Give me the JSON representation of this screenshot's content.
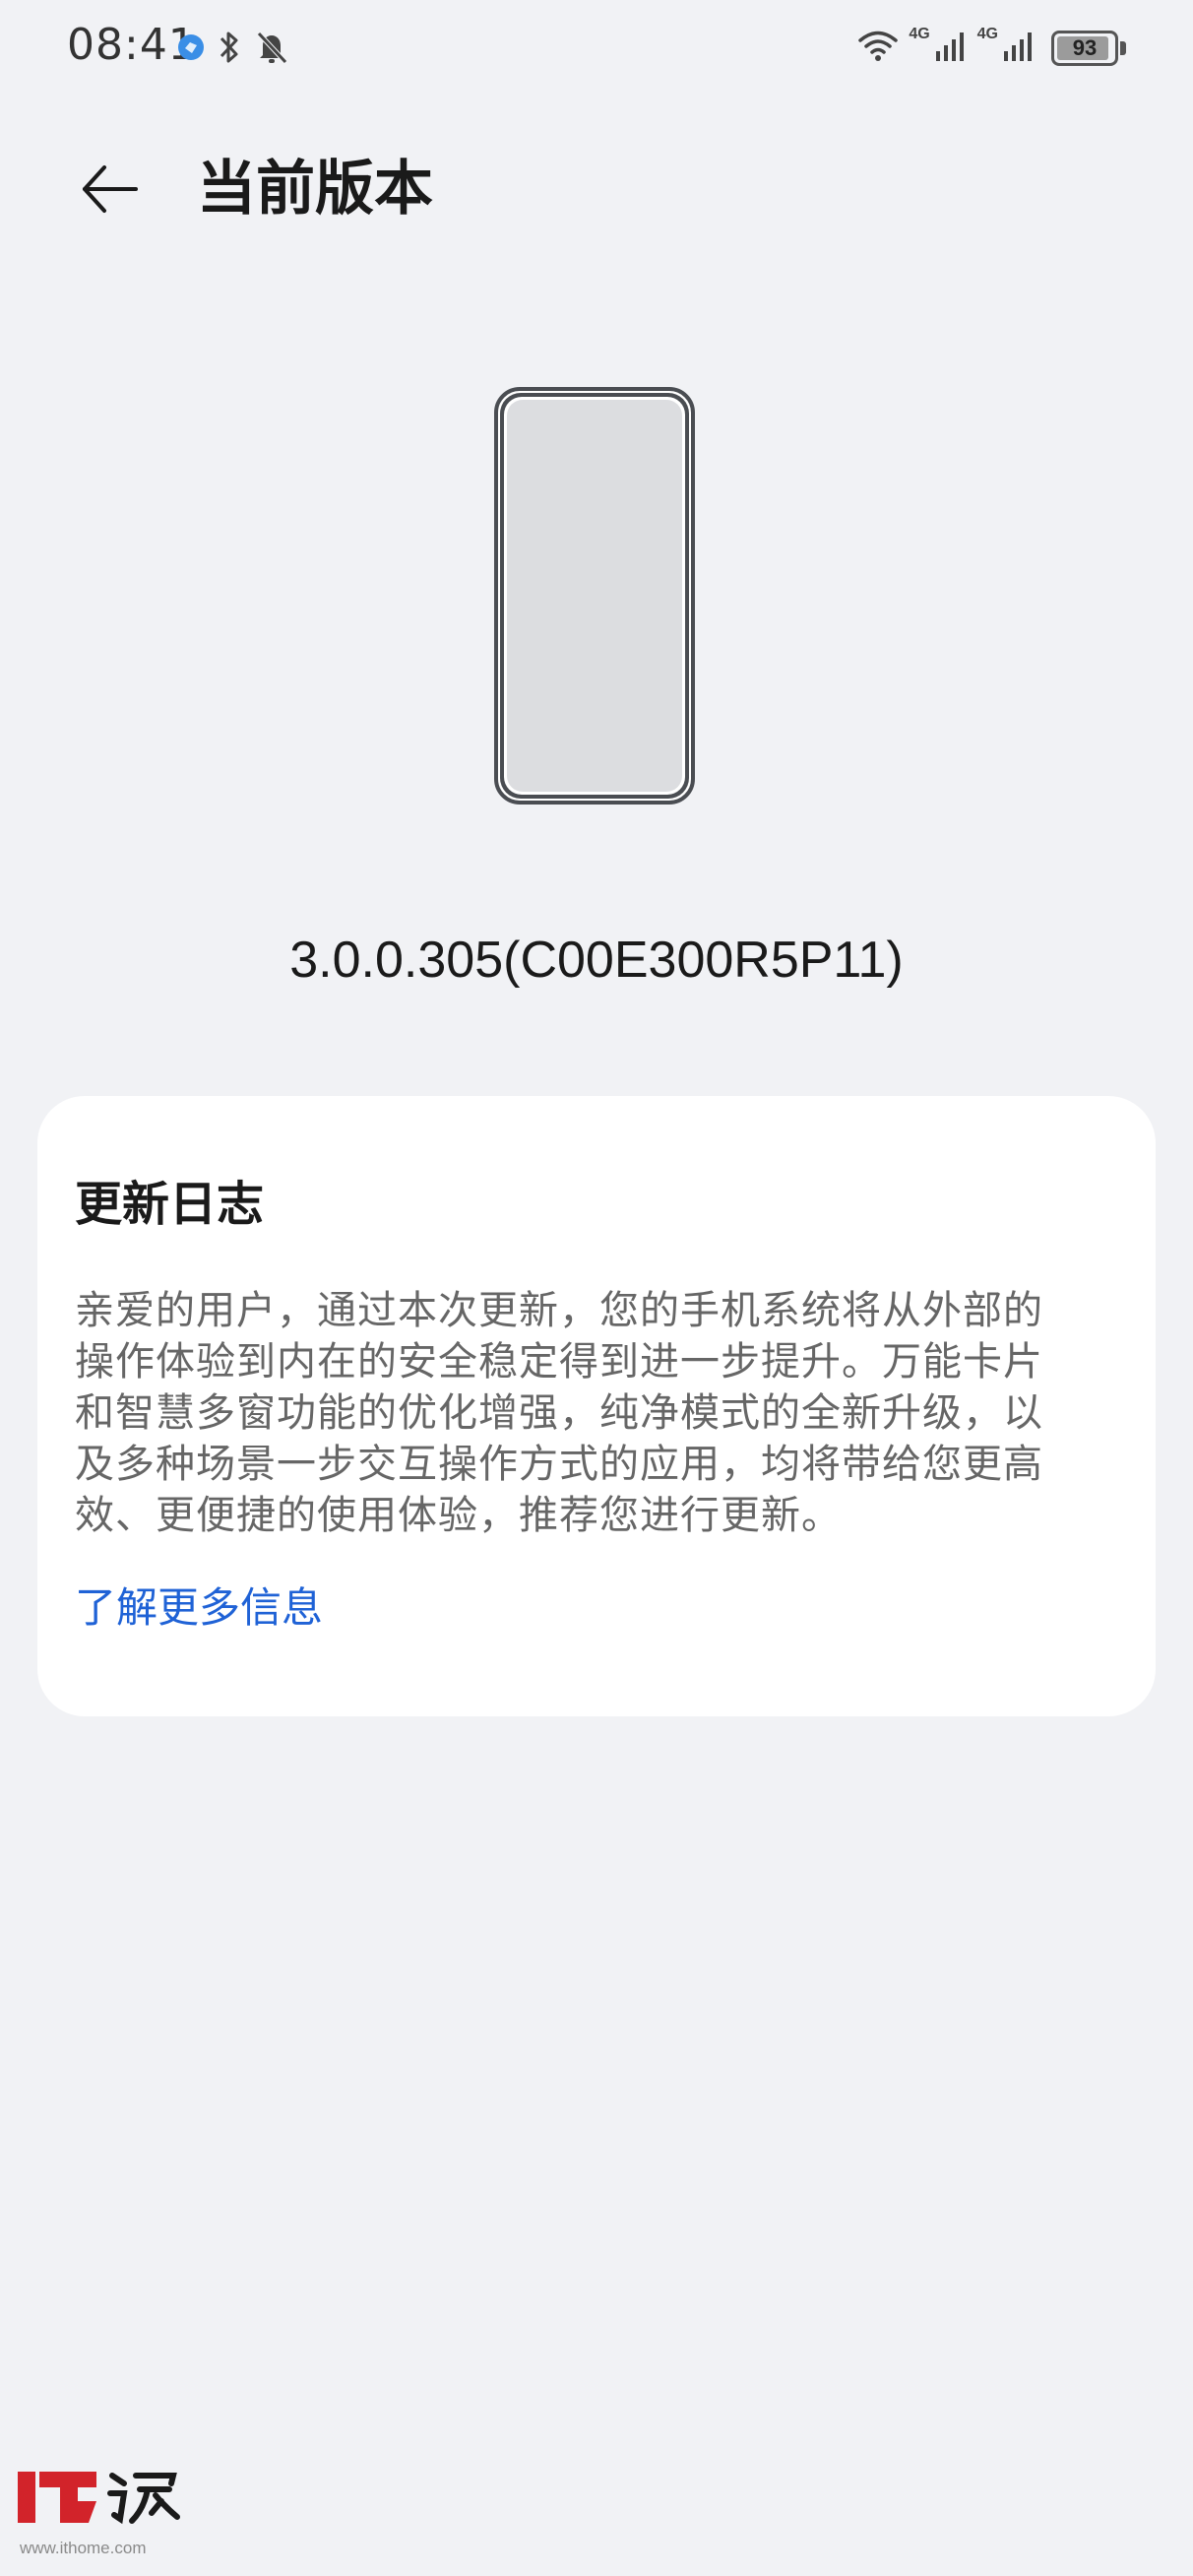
{
  "status_bar": {
    "time": "08:41",
    "network_1": "4G",
    "network_2": "4G",
    "battery_level": "93",
    "battery_fraction": 0.93,
    "icons": [
      "app-notification-icon",
      "bluetooth-icon",
      "mute-bell-icon",
      "wifi-icon",
      "signal-icon",
      "battery-icon"
    ]
  },
  "header": {
    "title": "当前版本",
    "back_icon": "arrow-left-icon"
  },
  "device": {
    "version": "3.0.0.305(C00E300R5P11)"
  },
  "changelog": {
    "title": "更新日志",
    "lines": [
      "亲爱的用户，通过本次更新，您的手机系统将从外部的",
      "操作体验到内在的安全稳定得到进一步提升。万能卡片",
      "和智慧多窗功能的优化增强，纯净模式的全新升级，以",
      "及多种场景一步交互操作方式的应用，均将带给您更高",
      "效、更便捷的使用体验，推荐您进行更新。"
    ],
    "more_link": "了解更多信息"
  },
  "watermark": {
    "logo_text": "IT之家",
    "url": "www.ithome.com"
  },
  "colors": {
    "background": "#f1f2f5",
    "card": "#ffffff",
    "link": "#1f62d6",
    "body_text": "#666666",
    "watermark_red": "#d2232a"
  }
}
